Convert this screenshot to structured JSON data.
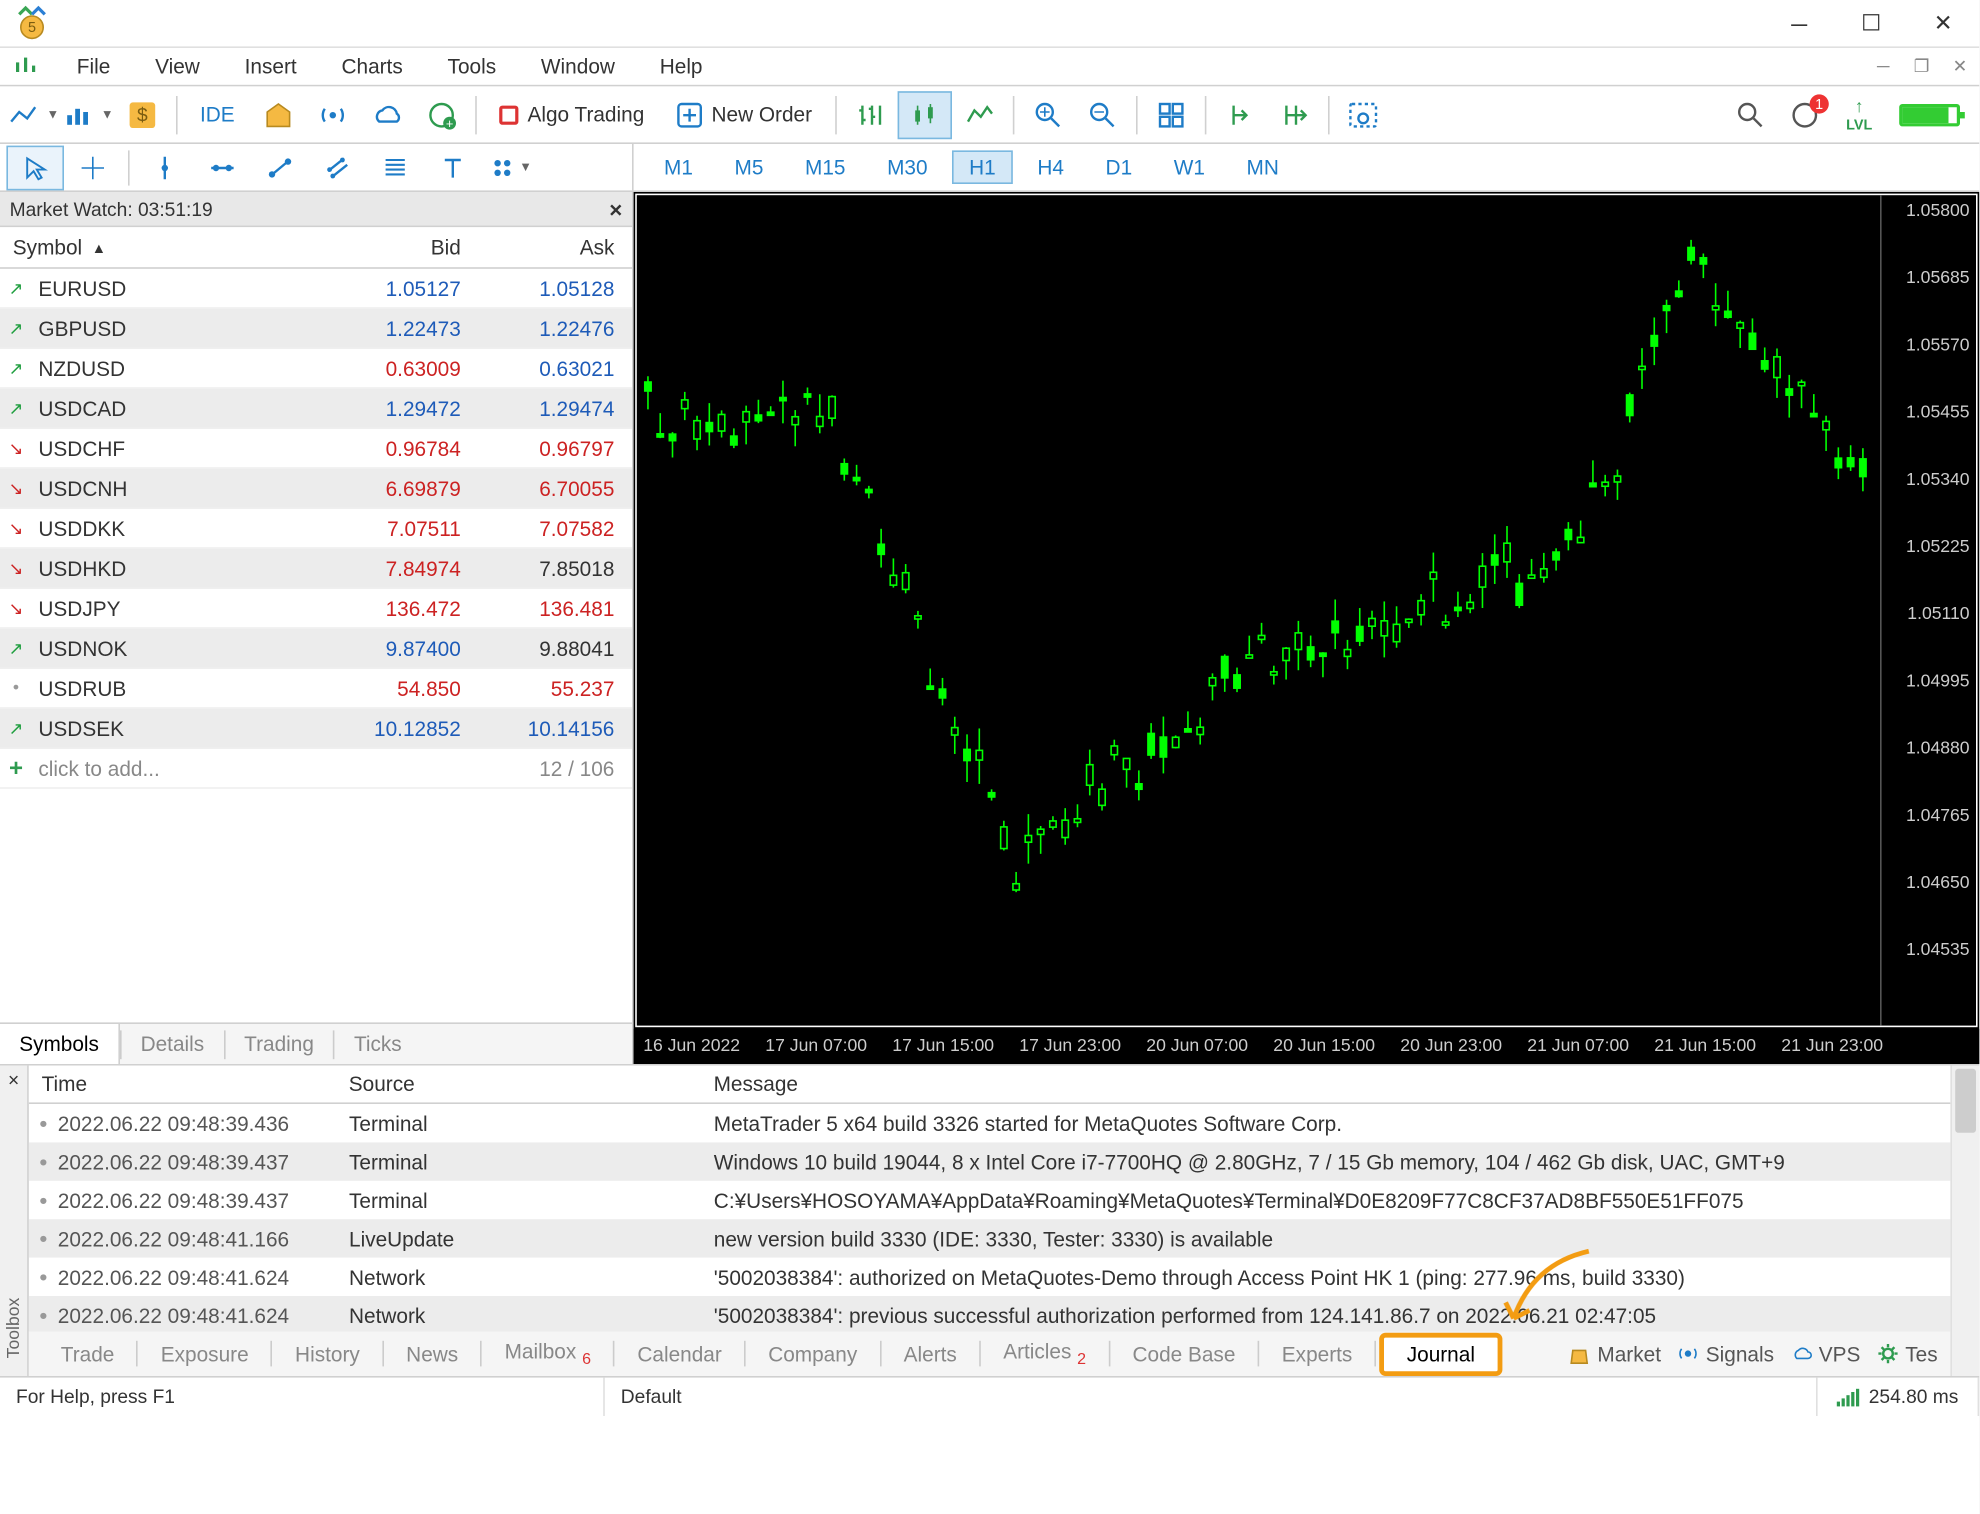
{
  "menubar": [
    "File",
    "View",
    "Insert",
    "Charts",
    "Tools",
    "Window",
    "Help"
  ],
  "toolbar": {
    "ide": "IDE",
    "algo": "Algo Trading",
    "neworder": "New Order",
    "lvl": "LVL",
    "notif_badge": "1"
  },
  "timeframes": [
    "M1",
    "M5",
    "M15",
    "M30",
    "H1",
    "H4",
    "D1",
    "W1",
    "MN"
  ],
  "timeframe_active": "H1",
  "marketwatch": {
    "title": "Market Watch: 03:51:19",
    "head": {
      "symbol": "Symbol",
      "bid": "Bid",
      "ask": "Ask"
    },
    "rows": [
      {
        "dir": "up",
        "sym": "EURUSD",
        "bid": "1.05127",
        "ask": "1.05128",
        "bidc": "blue",
        "askc": "blue"
      },
      {
        "dir": "up",
        "sym": "GBPUSD",
        "bid": "1.22473",
        "ask": "1.22476",
        "bidc": "blue",
        "askc": "blue"
      },
      {
        "dir": "up",
        "sym": "NZDUSD",
        "bid": "0.63009",
        "ask": "0.63021",
        "bidc": "red",
        "askc": "blue"
      },
      {
        "dir": "up",
        "sym": "USDCAD",
        "bid": "1.29472",
        "ask": "1.29474",
        "bidc": "blue",
        "askc": "blue"
      },
      {
        "dir": "dn",
        "sym": "USDCHF",
        "bid": "0.96784",
        "ask": "0.96797",
        "bidc": "red",
        "askc": "red"
      },
      {
        "dir": "dn",
        "sym": "USDCNH",
        "bid": "6.69879",
        "ask": "6.70055",
        "bidc": "red",
        "askc": "red"
      },
      {
        "dir": "dn",
        "sym": "USDDKK",
        "bid": "7.07511",
        "ask": "7.07582",
        "bidc": "red",
        "askc": "red"
      },
      {
        "dir": "dn",
        "sym": "USDHKD",
        "bid": "7.84974",
        "ask": "7.85018",
        "bidc": "red",
        "askc": ""
      },
      {
        "dir": "dn",
        "sym": "USDJPY",
        "bid": "136.472",
        "ask": "136.481",
        "bidc": "red",
        "askc": "red"
      },
      {
        "dir": "up",
        "sym": "USDNOK",
        "bid": "9.87400",
        "ask": "9.88041",
        "bidc": "blue",
        "askc": ""
      },
      {
        "dir": "dot",
        "sym": "USDRUB",
        "bid": "54.850",
        "ask": "55.237",
        "bidc": "red",
        "askc": "red"
      },
      {
        "dir": "up",
        "sym": "USDSEK",
        "bid": "10.12852",
        "ask": "10.14156",
        "bidc": "blue",
        "askc": "blue"
      }
    ],
    "add_label": "click to add...",
    "add_count": "12 / 106",
    "tabs": [
      "Symbols",
      "Details",
      "Trading",
      "Ticks"
    ]
  },
  "chart": {
    "time_labels": [
      "16 Jun 2022",
      "17 Jun 07:00",
      "17 Jun 15:00",
      "17 Jun 23:00",
      "20 Jun 07:00",
      "20 Jun 15:00",
      "20 Jun 23:00",
      "21 Jun 07:00",
      "21 Jun 15:00",
      "21 Jun 23:00"
    ],
    "price_labels": [
      "1.05800",
      "1.05685",
      "1.05570",
      "1.05455",
      "1.05340",
      "1.05225",
      "1.05110",
      "1.04995",
      "1.04880",
      "1.04765",
      "1.04650",
      "1.04535"
    ]
  },
  "toolbox": {
    "title": "Toolbox",
    "head": {
      "time": "Time",
      "source": "Source",
      "message": "Message"
    },
    "rows": [
      {
        "t": "2022.06.22 09:48:39.436",
        "s": "Terminal",
        "m": "MetaTrader 5 x64 build 3326 started for MetaQuotes Software Corp."
      },
      {
        "t": "2022.06.22 09:48:39.437",
        "s": "Terminal",
        "m": "Windows 10 build 19044, 8 x Intel Core i7-7700HQ  @ 2.80GHz, 7 / 15 Gb memory, 104 / 462 Gb disk, UAC, GMT+9"
      },
      {
        "t": "2022.06.22 09:48:39.437",
        "s": "Terminal",
        "m": "C:¥Users¥HOSOYAMA¥AppData¥Roaming¥MetaQuotes¥Terminal¥D0E8209F77C8CF37AD8BF550E51FF075"
      },
      {
        "t": "2022.06.22 09:48:41.166",
        "s": "LiveUpdate",
        "m": "new version build 3330 (IDE: 3330, Tester: 3330) is available"
      },
      {
        "t": "2022.06.22 09:48:41.624",
        "s": "Network",
        "m": "'5002038384': authorized on MetaQuotes-Demo through Access Point HK 1 (ping: 277.96 ms, build 3330)"
      },
      {
        "t": "2022.06.22 09:48:41.624",
        "s": "Network",
        "m": "'5002038384': previous successful authorization performed from 124.141.86.7 on 2022.06.21 02:47:05"
      }
    ],
    "tabs": [
      "Trade",
      "Exposure",
      "History",
      "News",
      "Mailbox",
      "Calendar",
      "Company",
      "Alerts",
      "Articles",
      "Code Base",
      "Experts",
      "Journal"
    ],
    "tabs_active": "Journal",
    "mailbox_badge": "6",
    "articles_badge": "2",
    "right_items": {
      "market": "Market",
      "signals": "Signals",
      "vps": "VPS",
      "tes": "Tes"
    }
  },
  "statusbar": {
    "help": "For Help, press F1",
    "profile": "Default",
    "ping": "254.80 ms"
  }
}
